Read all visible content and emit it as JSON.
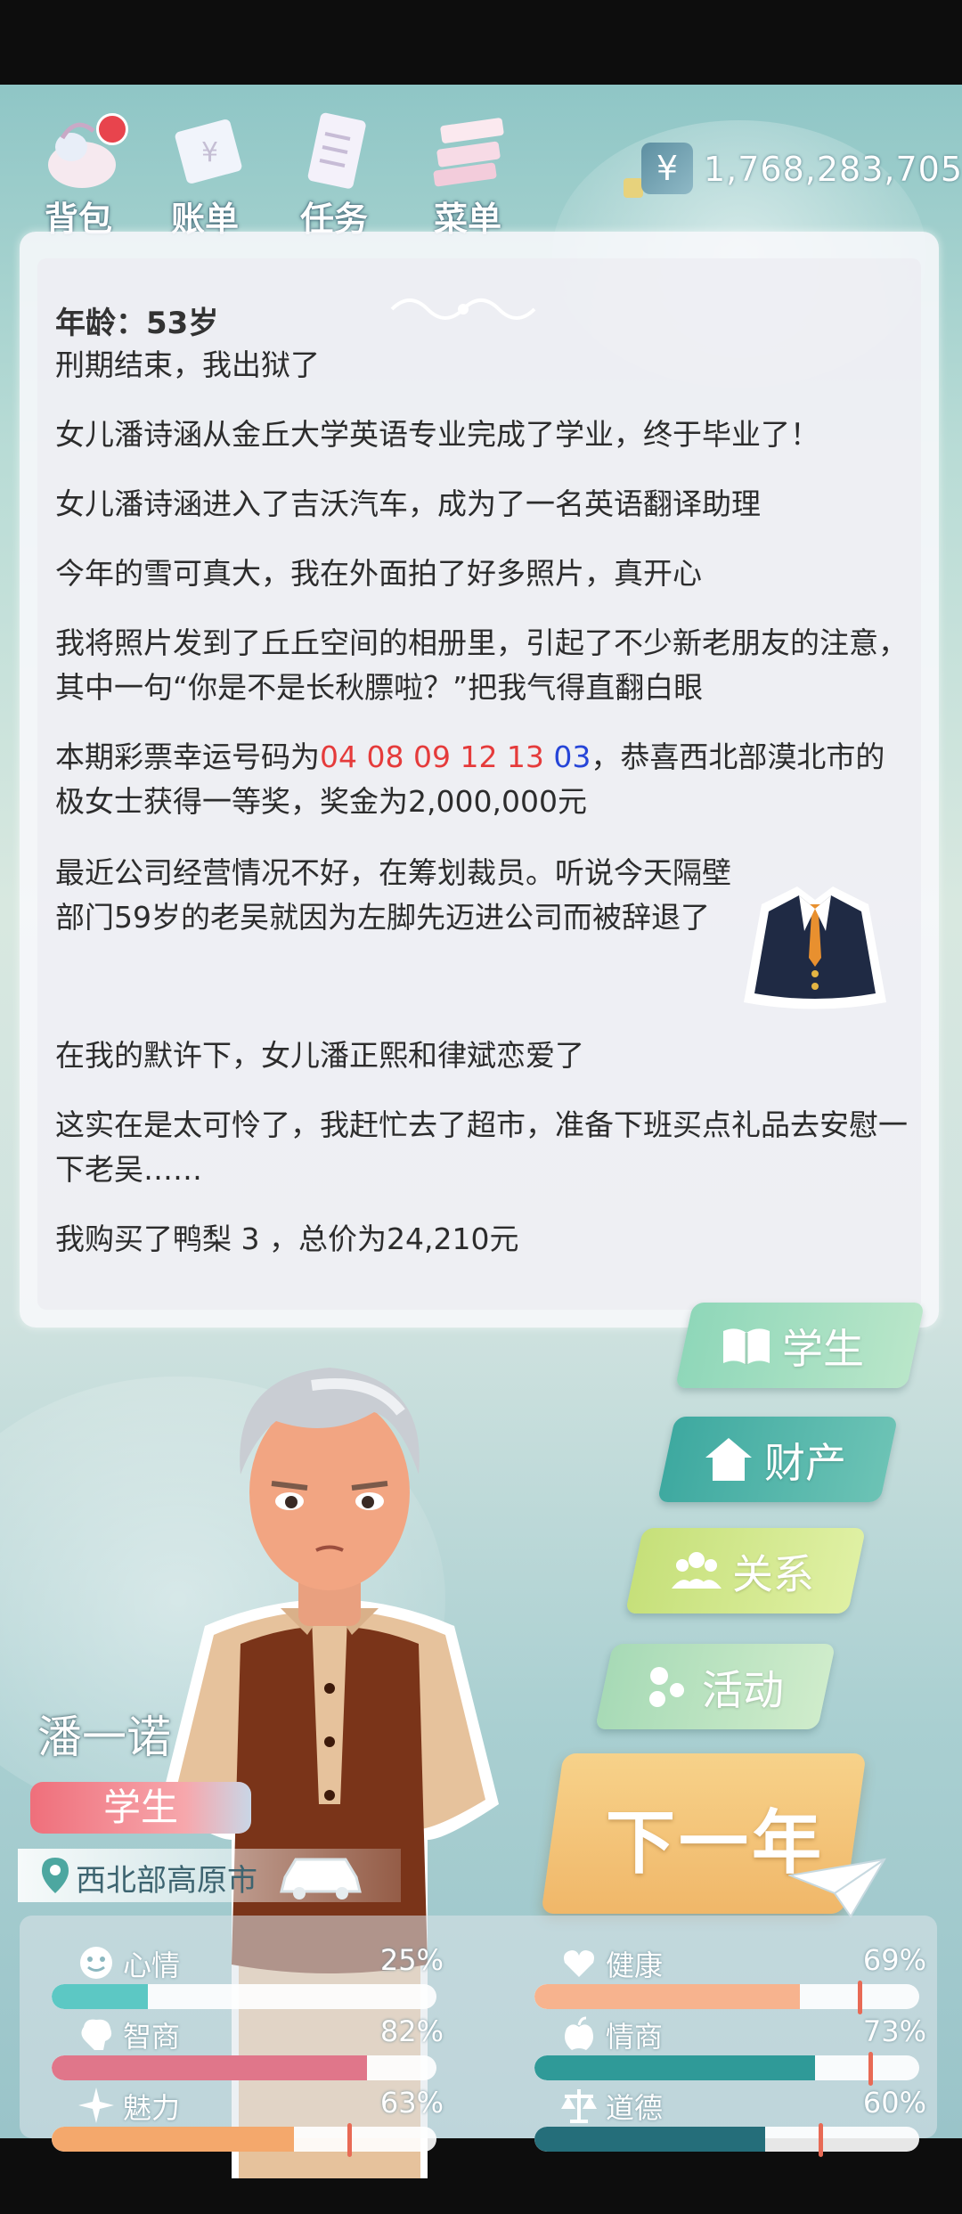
{
  "top_nav": {
    "bag_label": "背包",
    "bill_label": "账单",
    "task_label": "任务",
    "menu_label": "菜单"
  },
  "money": {
    "currency_symbol": "¥",
    "amount": "1,768,283,705"
  },
  "story": {
    "age": "年龄：53岁",
    "events": [
      "刑期结束，我出狱了",
      "女儿潘诗涵从金丘大学英语专业完成了学业，终于毕业了！",
      "女儿潘诗涵进入了吉沃汽车，成为了一名英语翻译助理",
      "今年的雪可真大，我在外面拍了好多照片，真开心",
      "我将照片发到了丘丘空间的相册里，引起了不少新老朋友的注意，其中一句“你是不是长秋膘啦？”把我气得直翻白眼"
    ],
    "lottery_prefix": "本期彩票幸运号码为",
    "lottery_red": "04 08 09 12 13",
    "lottery_blue": "03",
    "lottery_suffix": "，恭喜西北部漠北市的极女士获得一等奖，奖金为2,000,000元",
    "events_after": [
      "最近公司经营情况不好，在筹划裁员。听说今天隔壁部门59岁的老吴就因为左脚先迈进公司而被辞退了",
      "在我的默许下，女儿潘正熙和律斌恋爱了",
      "这实在是太可怜了，我赶忙去了超市，准备下班买点礼品去安慰一下老吴……",
      "我购买了鸭梨 3 ，总价为24,210元"
    ]
  },
  "actions": {
    "student": "学生",
    "property": "财产",
    "relation": "关系",
    "activity": "活动",
    "next_year": "下一年"
  },
  "character": {
    "name": "潘一诺",
    "job": "学生",
    "location": "西北部高原市"
  },
  "stats": [
    {
      "label": "心情",
      "value": "25%",
      "fraction": 0.25,
      "color": "#5cc8c4",
      "icon": "smile-icon"
    },
    {
      "label": "健康",
      "value": "69%",
      "fraction": 0.69,
      "color": "#f7b38e",
      "icon": "heart-icon"
    },
    {
      "label": "智商",
      "value": "82%",
      "fraction": 0.82,
      "color": "#e0768a",
      "icon": "brain-icon"
    },
    {
      "label": "情商",
      "value": "73%",
      "fraction": 0.73,
      "color": "#2f9a98",
      "icon": "apple-icon"
    },
    {
      "label": "魅力",
      "value": "63%",
      "fraction": 0.63,
      "color": "#f4a86c",
      "icon": "sparkle-icon"
    },
    {
      "label": "道德",
      "value": "60%",
      "fraction": 0.6,
      "color": "#256e7a",
      "icon": "scales-icon"
    }
  ]
}
